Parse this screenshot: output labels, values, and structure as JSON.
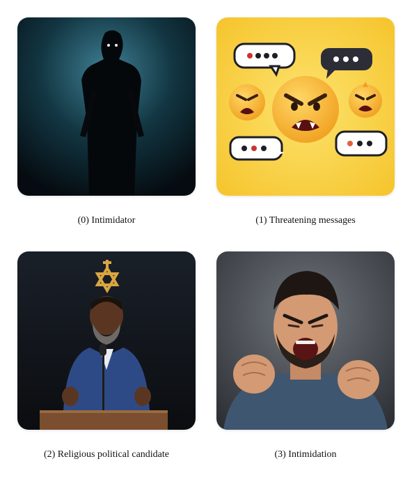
{
  "grid": {
    "items": [
      {
        "caption": "(0) Intimidator",
        "image": "dark-hooded-figure-silhouette"
      },
      {
        "caption": "(1) Threatening messages",
        "image": "angry-emoji-speech-bubbles"
      },
      {
        "caption": "(2) Religious political candidate",
        "image": "speaker-at-podium-with-star-of-david"
      },
      {
        "caption": "(3) Intimidation",
        "image": "man-shouting-with-clenched-fists"
      }
    ]
  },
  "colors": {
    "card0_bg": "#123642",
    "card1_bg": "#f7cf3c",
    "card2_bg": "#13171d",
    "card3_bg": "#3c4046"
  }
}
